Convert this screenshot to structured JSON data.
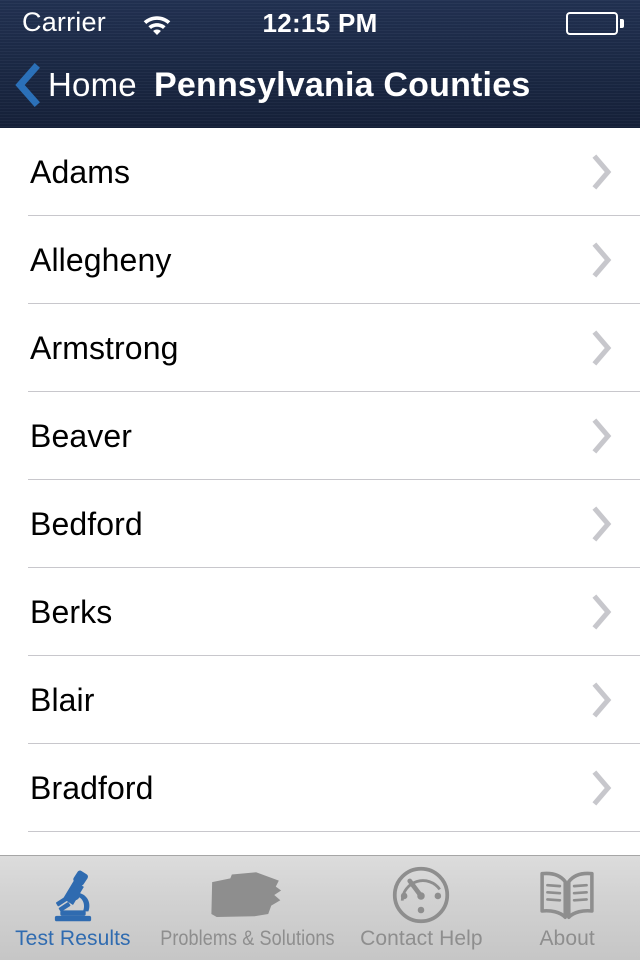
{
  "status_bar": {
    "carrier": "Carrier",
    "wifi_icon": "wifi-icon",
    "time": "12:15 PM",
    "battery_icon": "battery-full-icon"
  },
  "navigation_bar": {
    "back_icon": "chevron-left-icon",
    "back_label": "Home",
    "title": "Pennsylvania Counties",
    "background_color": "#1c2a47",
    "back_tint_color": "#2b70b8"
  },
  "list": {
    "chevron_icon": "chevron-right-icon",
    "separator_color": "#c8c7cc",
    "items": [
      {
        "label": "Adams"
      },
      {
        "label": "Allegheny"
      },
      {
        "label": "Armstrong"
      },
      {
        "label": "Beaver"
      },
      {
        "label": "Bedford"
      },
      {
        "label": "Berks"
      },
      {
        "label": "Blair"
      },
      {
        "label": "Bradford"
      }
    ]
  },
  "tab_bar": {
    "active_color": "#2f6bb0",
    "inactive_color": "#8e8e8e",
    "tabs": [
      {
        "label": "Test Results",
        "icon": "microscope-icon",
        "active": true
      },
      {
        "label": "Problems & Solutions",
        "icon": "pennsylvania-state-icon",
        "active": false
      },
      {
        "label": "Contact Help",
        "icon": "gauge-icon",
        "active": false
      },
      {
        "label": "About",
        "icon": "open-book-icon",
        "active": false
      }
    ]
  }
}
